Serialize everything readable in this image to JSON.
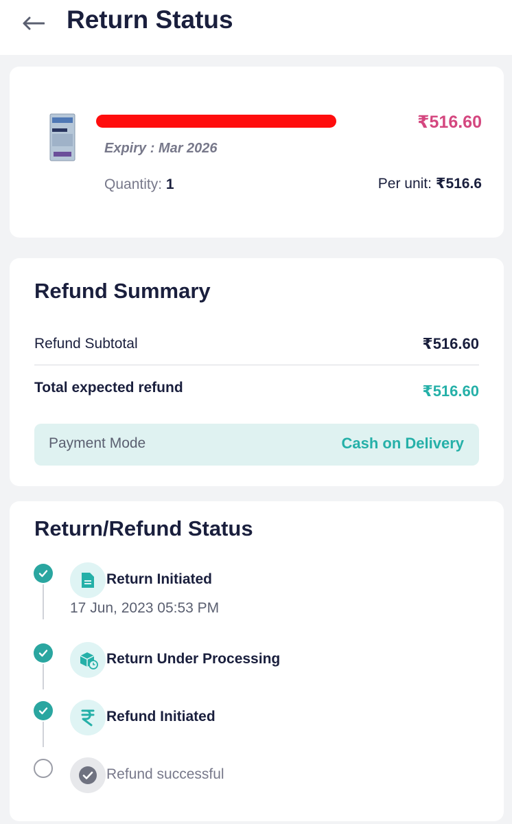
{
  "header": {
    "title": "Return Status"
  },
  "product": {
    "price": "₹516.60",
    "expiry": "Expiry : Mar 2026",
    "quantity_label": "Quantity:",
    "quantity_value": "1",
    "per_unit_label": "Per unit:",
    "per_unit_value": "₹516.6"
  },
  "refund_summary": {
    "title": "Refund Summary",
    "subtotal_label": "Refund Subtotal",
    "subtotal_value": "₹516.60",
    "total_label": "Total expected refund",
    "total_value": "₹516.60",
    "payment_mode_label": "Payment Mode",
    "payment_mode_value": "Cash on Delivery"
  },
  "status": {
    "title": "Return/Refund Status",
    "steps": [
      {
        "label": "Return Initiated",
        "date": "17 Jun, 2023 05:53 PM",
        "done": true,
        "icon": "document-icon"
      },
      {
        "label": "Return Under Processing",
        "done": true,
        "icon": "box-clock-icon"
      },
      {
        "label": "Refund Initiated",
        "done": true,
        "icon": "rupee-icon"
      },
      {
        "label": "Refund successful",
        "done": false,
        "icon": "check-circle-icon"
      }
    ]
  },
  "colors": {
    "accent_teal": "#25b0a8",
    "price_pink": "#d4477f",
    "text_dark": "#1a1f3d",
    "redaction_red": "#ff0d0d"
  }
}
